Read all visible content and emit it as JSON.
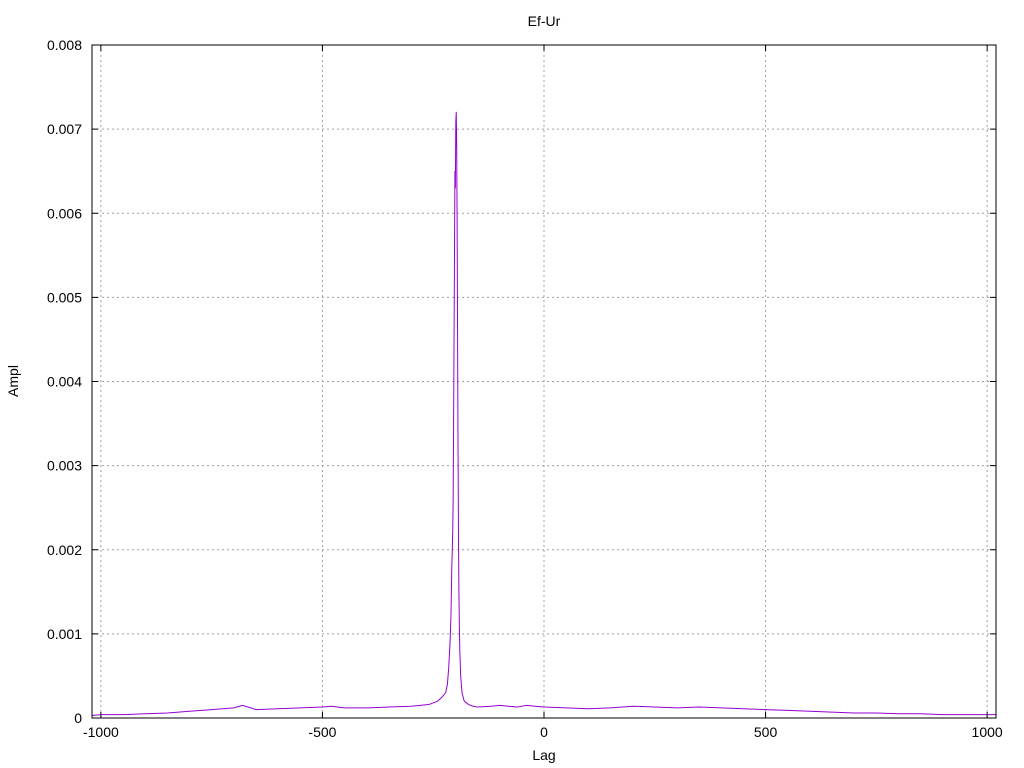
{
  "chart_data": {
    "type": "line",
    "title": "Ef-Ur",
    "xlabel": "Lag",
    "ylabel": "Ampl",
    "xlim": [
      -1020,
      1020
    ],
    "ylim": [
      0,
      0.008
    ],
    "grid": true,
    "x_ticks": [
      -1000,
      -500,
      0,
      500,
      1000
    ],
    "y_ticks": [
      0,
      0.001,
      0.002,
      0.003,
      0.004,
      0.005,
      0.006,
      0.007,
      0.008
    ],
    "x_tick_labels": [
      "-1000",
      "-500",
      "0",
      "500",
      "1000"
    ],
    "y_tick_labels": [
      "0",
      "0.001",
      "0.002",
      "0.003",
      "0.004",
      "0.005",
      "0.006",
      "0.007",
      "0.008"
    ],
    "colors": {
      "series": "#9400d3",
      "grid": "#a0a0a0",
      "frame": "#000000"
    },
    "series": [
      {
        "x": [
          -1020,
          -1000,
          -950,
          -900,
          -850,
          -800,
          -750,
          -700,
          -680,
          -650,
          -600,
          -550,
          -500,
          -480,
          -450,
          -400,
          -350,
          -300,
          -260,
          -240,
          -230,
          -222,
          -218,
          -215,
          -212,
          -210,
          -208,
          -206,
          -205,
          -204,
          -203,
          -202,
          -201,
          -200,
          -199,
          -198,
          -197,
          -196,
          -195,
          -194,
          -193,
          -192,
          -191,
          -190,
          -188,
          -185,
          -180,
          -170,
          -160,
          -150,
          -120,
          -100,
          -80,
          -60,
          -40,
          -20,
          0,
          50,
          100,
          150,
          200,
          250,
          300,
          350,
          400,
          450,
          500,
          550,
          600,
          650,
          700,
          750,
          800,
          850,
          900,
          950,
          1000,
          1020
        ],
        "y": [
          3e-05,
          4e-05,
          4e-05,
          5e-05,
          6e-05,
          8e-05,
          0.0001,
          0.00012,
          0.00015,
          0.0001,
          0.00011,
          0.00012,
          0.00013,
          0.00014,
          0.00012,
          0.00012,
          0.00013,
          0.00014,
          0.00016,
          0.0002,
          0.00025,
          0.0003,
          0.0004,
          0.0006,
          0.0009,
          0.0012,
          0.0018,
          0.0022,
          0.0026,
          0.0035,
          0.0045,
          0.0055,
          0.0065,
          0.0063,
          0.0071,
          0.0072,
          0.0068,
          0.0058,
          0.0045,
          0.0032,
          0.0022,
          0.0015,
          0.0011,
          0.0008,
          0.0005,
          0.0003,
          0.0002,
          0.00016,
          0.00014,
          0.00013,
          0.00014,
          0.00015,
          0.00014,
          0.00013,
          0.00015,
          0.00014,
          0.00013,
          0.00012,
          0.00011,
          0.00012,
          0.00014,
          0.00013,
          0.00012,
          0.00013,
          0.00012,
          0.00011,
          0.0001,
          9e-05,
          8e-05,
          7e-05,
          6e-05,
          6e-05,
          5e-05,
          5e-05,
          4e-05,
          4e-05,
          4e-05,
          4e-05
        ]
      }
    ]
  }
}
